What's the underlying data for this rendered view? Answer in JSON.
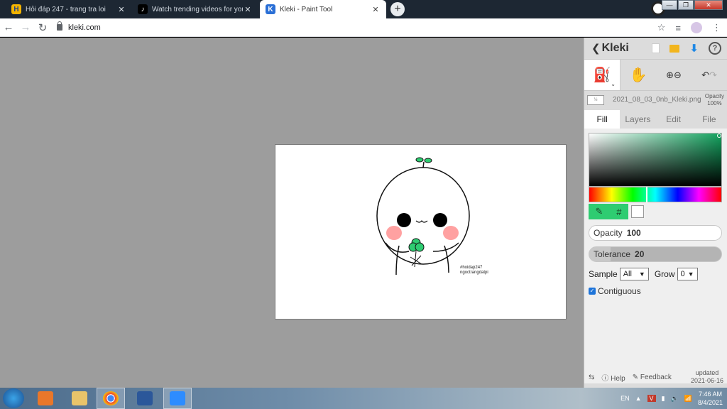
{
  "browser": {
    "tabs": [
      {
        "title": "Hỏi đáp 247 - trang tra loi",
        "icon": "hoidap-favicon",
        "active": false
      },
      {
        "title": "Watch trending videos for you | T",
        "icon": "tiktok-favicon",
        "active": false
      },
      {
        "title": "Kleki - Paint Tool",
        "icon": "kleki-favicon",
        "active": true
      }
    ],
    "url": "kleki.com",
    "new_tab": "+"
  },
  "canvas": {
    "watermark_line1": "#hoidap247",
    "watermark_line2": "ngoctrangdatpi"
  },
  "kleki": {
    "logo": "Kleki",
    "file_thumb_label": "½",
    "file_name": "2021_08_03_0nb_Kleki.png",
    "opacity_label": "Opacity",
    "opacity_value": "100%",
    "tabs": [
      "Fill",
      "Layers",
      "Edit",
      "File"
    ],
    "active_tab": "Fill",
    "color_primary": "#2ecc71",
    "color_secondary": "#ffffff",
    "hex_symbol": "#",
    "opacity_slider_label": "Opacity",
    "opacity_slider_value": "100",
    "tolerance_label": "Tolerance",
    "tolerance_value": "20",
    "sample_label": "Sample",
    "sample_value": "All",
    "grow_label": "Grow",
    "grow_value": "0",
    "contiguous_label": "Contiguous",
    "contiguous_checked": true,
    "help_label": "Help",
    "feedback_label": "Feedback",
    "updated_label": "updated",
    "updated_date": "2021-06-16"
  },
  "taskbar": {
    "lang": "EN",
    "time": "7:46 AM",
    "date": "8/4/2021"
  }
}
